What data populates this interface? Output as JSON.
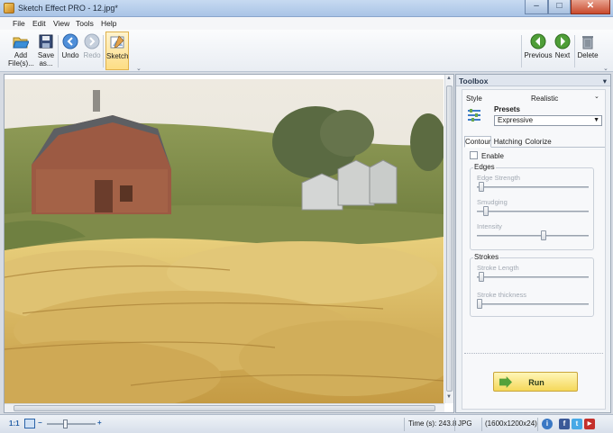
{
  "window": {
    "title": "Sketch Effect PRO - 12.jpg*"
  },
  "menu": [
    "File",
    "Edit",
    "View",
    "Tools",
    "Help"
  ],
  "toolbar": {
    "add_files": "Add File(s)...",
    "save_as": "Save as...",
    "undo": "Undo",
    "redo": "Redo",
    "sketch": "Sketch",
    "previous": "Previous",
    "next": "Next",
    "delete": "Delete"
  },
  "toolbox": {
    "title": "Toolbox",
    "style_label": "Style",
    "style_value": "Realistic",
    "presets_label": "Presets",
    "presets_value": "Expressive",
    "tabs": [
      "Contour",
      "Hatching",
      "Colorize"
    ],
    "enable_label": "Enable",
    "enable_checked": false,
    "edges_group": "Edges",
    "edges_sliders": [
      {
        "label": "Edge Strength",
        "value": 0.02
      },
      {
        "label": "Smudging",
        "value": 0.06
      },
      {
        "label": "Intensity",
        "value": 0.6
      }
    ],
    "strokes_group": "Strokes",
    "strokes_sliders": [
      {
        "label": "Stroke Length",
        "value": 0.02
      },
      {
        "label": "Stroke thickness",
        "value": 0.0
      }
    ],
    "run_label": "Run"
  },
  "status": {
    "zoom": "1:1",
    "zoom_level": 0.35,
    "time": "Time (s): 243.8",
    "format": "JPG",
    "dimensions": "(1600x1200x24)",
    "social": [
      "info-icon",
      "facebook-icon",
      "twitter-icon",
      "youtube-icon"
    ]
  },
  "colors": {
    "accent": "#fddd84",
    "run": "#f5d85a",
    "title": "#a9c4e6"
  }
}
